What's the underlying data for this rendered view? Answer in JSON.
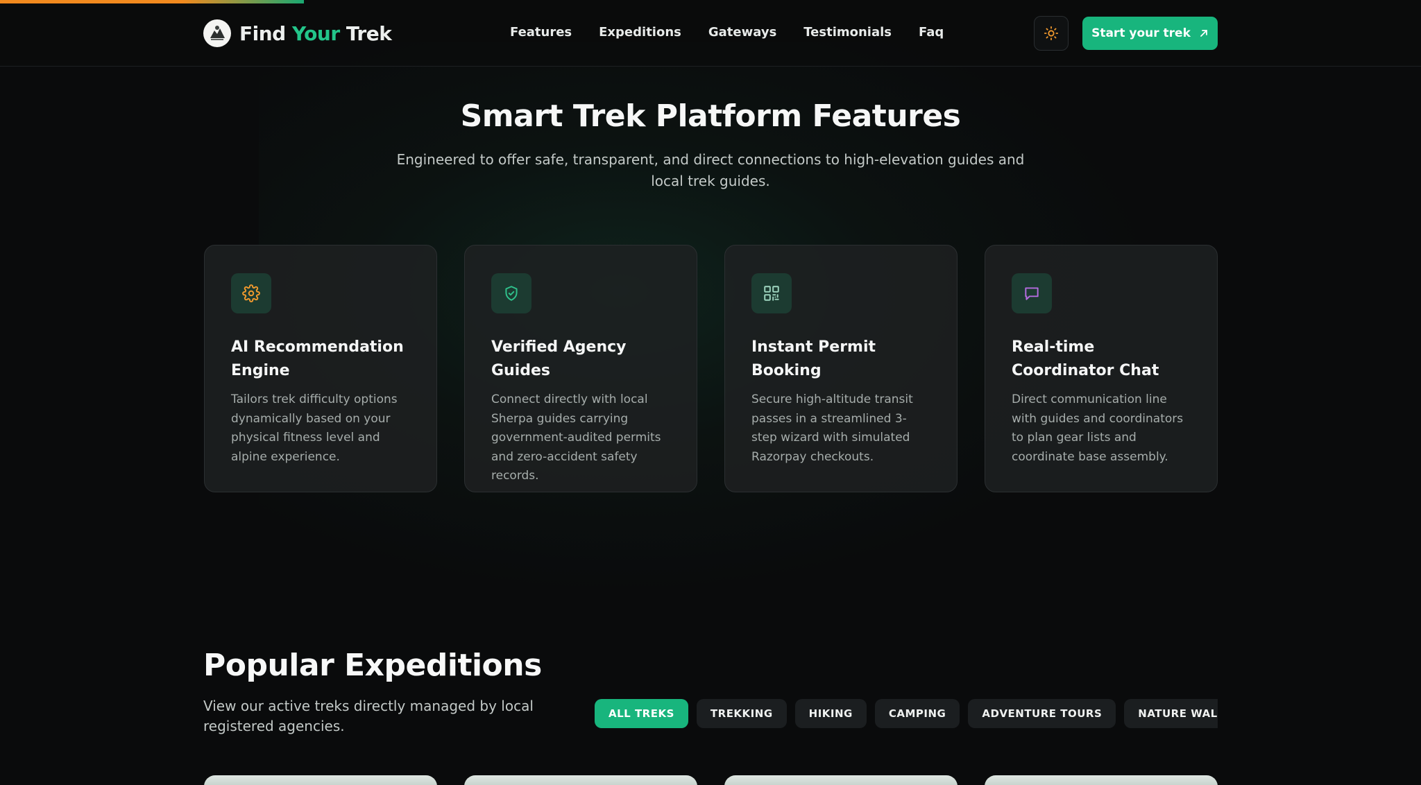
{
  "progress": {
    "fraction": 0.214
  },
  "header": {
    "brand_prefix": "Find ",
    "brand_accent": "Your",
    "brand_suffix": " Trek",
    "logo_icon": "trek-logo-icon",
    "nav": [
      "Features",
      "Expeditions",
      "Gateways",
      "Testimonials",
      "Faq"
    ],
    "theme_icon": "sun-icon",
    "cta_label": "Start your trek",
    "cta_icon": "arrow-up-right-icon"
  },
  "features": {
    "title": "Smart Trek Platform Features",
    "subtitle": "Engineered to offer safe, transparent, and direct connections to high-elevation guides and local trek guides.",
    "cards": [
      {
        "icon": "gear-icon",
        "title": "AI Recommendation Engine",
        "desc": "Tailors trek difficulty options dynamically based on your physical fitness level and alpine experience."
      },
      {
        "icon": "shield-check-icon",
        "title": "Verified Agency Guides",
        "desc": "Connect directly with local Sherpa guides carrying government-audited permits and zero-accident safety records."
      },
      {
        "icon": "qr-code-icon",
        "title": "Instant Permit Booking",
        "desc": "Secure high-altitude transit passes in a streamlined 3-step wizard with simulated Razorpay checkouts."
      },
      {
        "icon": "chat-bubble-icon",
        "title": "Real-time Coordinator Chat",
        "desc": "Direct communication line with guides and coordinators to plan gear lists and coordinate base assembly."
      }
    ]
  },
  "expeditions": {
    "title": "Popular Expeditions",
    "subtitle": "View our active treks directly managed by local registered agencies.",
    "filters": [
      "ALL TREKS",
      "TREKKING",
      "HIKING",
      "CAMPING",
      "ADVENTURE TOURS",
      "NATURE WALKS",
      "W"
    ]
  },
  "colors": {
    "accent": "#18b57d",
    "progress_orange": "#f28a1e",
    "background": "#0a0b0c",
    "icon_orange": "#f29a2e",
    "icon_green": "#2fc28c",
    "icon_teal": "#9fd6c0",
    "icon_purple": "#b56be0"
  }
}
